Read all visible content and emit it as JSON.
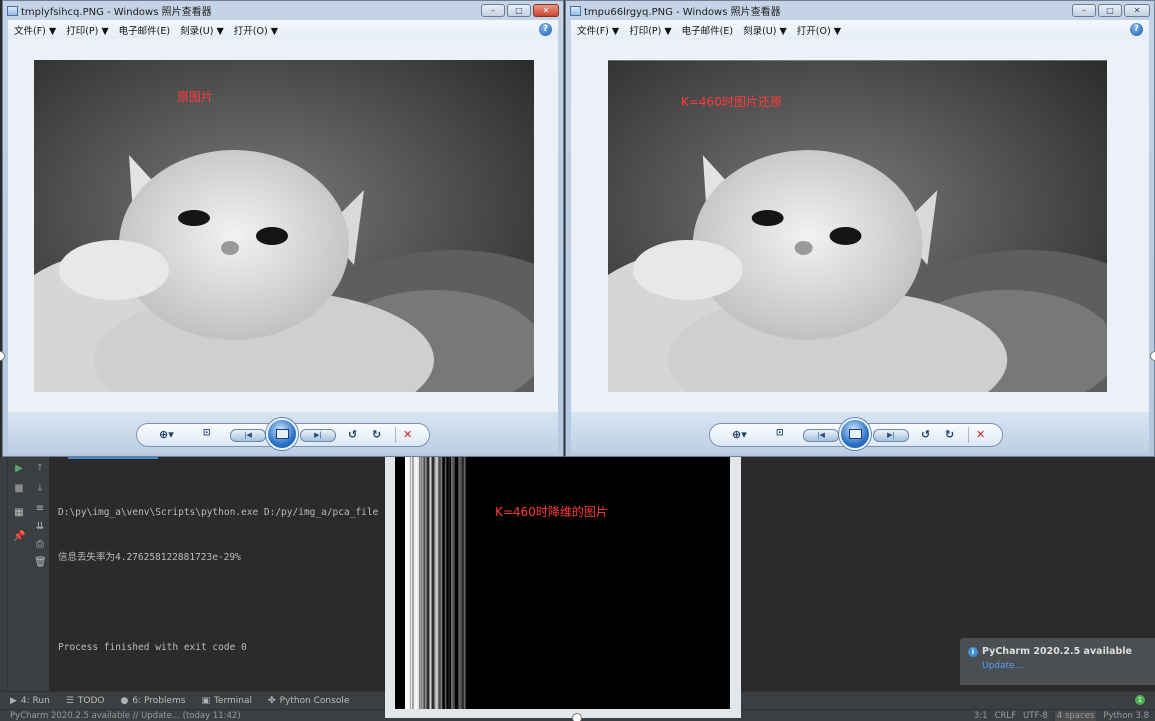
{
  "window_left": {
    "title": "tmplyfsihcq.PNG - Windows 照片查看器",
    "menu": [
      "文件(F) ▼",
      "打印(P) ▼",
      "电子邮件(E)",
      "刻录(U) ▼",
      "打开(O) ▼"
    ],
    "image_label": "原图片",
    "controls": [
      "zoom-icon",
      "fit-icon",
      "previous-icon",
      "slideshow-icon",
      "next-icon",
      "rotate-ccw-icon",
      "rotate-cw-icon",
      "delete-icon"
    ]
  },
  "window_right": {
    "title": "tmpu66lrgyq.PNG - Windows 照片查看器",
    "menu": [
      "文件(F) ▼",
      "打印(P) ▼",
      "电子邮件(E)",
      "刻录(U) ▼",
      "打开(O) ▼"
    ],
    "image_label": "K=460时图片还原"
  },
  "reduced_window": {
    "image_label": "K=460时降维的图片"
  },
  "console": {
    "lines": [
      "D:\\py\\img_a\\venv\\Scripts\\python.exe D:/py/img_a/pca_file",
      "信息丢失率为4.276258122881723e-29%",
      "",
      "Process finished with exit code 0"
    ]
  },
  "bottom_tabs": [
    {
      "icon": "▶",
      "label": "4: Run"
    },
    {
      "icon": "☰",
      "label": "TODO"
    },
    {
      "icon": "●",
      "label": "6: Problems"
    },
    {
      "icon": "▣",
      "label": "Terminal"
    },
    {
      "icon": "✤",
      "label": "Python Console"
    }
  ],
  "status_bar": {
    "left": "PyCharm 2020.2.5 available // Update... (today 11:42)",
    "position": "3:1",
    "line_sep": "CRLF",
    "encoding": "UTF-8",
    "indent": "4 spaces",
    "interpreter": "Python 3.8"
  },
  "notification": {
    "title": "PyCharm 2020.2.5 available",
    "link": "Update..."
  },
  "colors": {
    "accent_red": "#ff3b3b",
    "ide_bg": "#2b2b2b",
    "ide_panel": "#3c3f41",
    "link_blue": "#589df6"
  }
}
